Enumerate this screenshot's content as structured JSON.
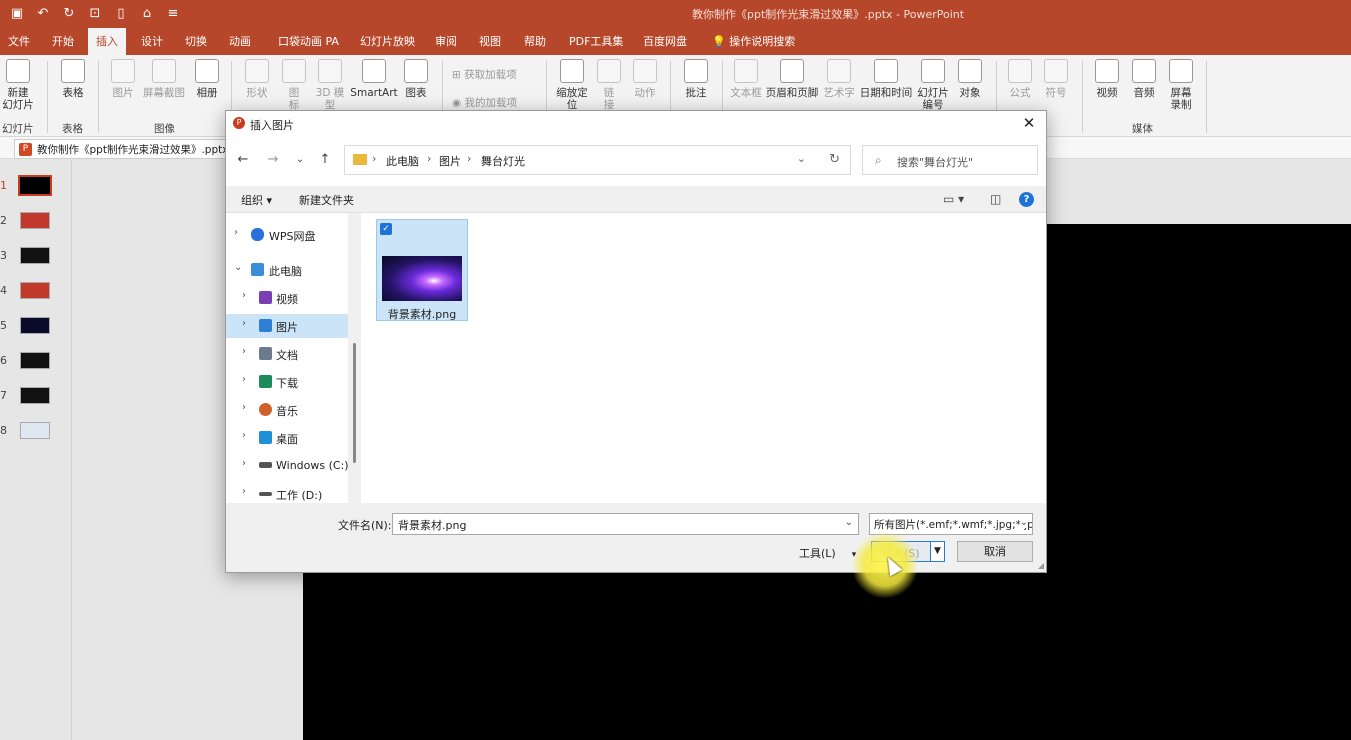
{
  "window": {
    "title": "教你制作《ppt制作光束滑过效果》.pptx - PowerPoint"
  },
  "menu": {
    "tabs": [
      "文件",
      "开始",
      "插入",
      "设计",
      "切换",
      "动画",
      "口袋动画 PA",
      "幻灯片放映",
      "审阅",
      "视图",
      "帮助",
      "PDF工具集",
      "百度网盘"
    ],
    "active": "插入",
    "tell_me": "操作说明搜索"
  },
  "ribbon": {
    "new_slide": "新建\n幻灯片",
    "table": "表格",
    "picture": "图片",
    "screenshot": "屏幕截图",
    "album": "相册",
    "shapes": "形状",
    "icons": "图\n标",
    "model3d": "3D 模\n型",
    "smartart": "SmartArt",
    "chart": "图表",
    "get_addins": "获取加载项",
    "my_addins": "我的加载项",
    "zoom": "缩放定\n位",
    "link": "链\n接",
    "action": "动作",
    "comment": "批注",
    "textbox": "文本框",
    "header_footer": "页眉和页脚",
    "wordart": "艺术字",
    "datetime": "日期和时间",
    "slide_number": "幻灯片\n编号",
    "object": "对象",
    "equation": "公式",
    "symbol": "符号",
    "video": "视频",
    "audio": "音频",
    "screen_record": "屏幕\n录制",
    "groups": {
      "slides": "幻灯片",
      "tables": "表格",
      "images": "图像",
      "media": "媒体"
    }
  },
  "doc_tab": "教你制作《ppt制作光束滑过效果》.pptx",
  "slides": {
    "numbers": [
      "1",
      "2",
      "3",
      "4",
      "5",
      "6",
      "7",
      "8"
    ],
    "selected": "1",
    "thumb_colors": [
      "#000000",
      "#c0392b",
      "#111111",
      "#c0392b",
      "#0a0a2a",
      "#111111",
      "#111111",
      "#dfe8f2"
    ]
  },
  "dialog": {
    "title": "插入图片",
    "close": "✕",
    "breadcrumb": [
      "此电脑",
      "图片",
      "舞台灯光"
    ],
    "search_placeholder": "搜索\"舞台灯光\"",
    "organize": "组织 ▾",
    "new_folder": "新建文件夹",
    "nav": [
      {
        "label": "WPS网盘",
        "color": "#2b6fdc"
      },
      {
        "label": "此电脑",
        "color": "#3a8fd8"
      },
      {
        "label": "视频",
        "color": "#7a3fb3"
      },
      {
        "label": "图片",
        "color": "#2f7fd6"
      },
      {
        "label": "文档",
        "color": "#6b7b8c"
      },
      {
        "label": "下载",
        "color": "#1e8c5a"
      },
      {
        "label": "音乐",
        "color": "#d0602a"
      },
      {
        "label": "桌面",
        "color": "#1e90d6"
      },
      {
        "label": "Windows (C:)",
        "color": "#555555"
      },
      {
        "label": "工作 (D:)",
        "color": "#555555"
      }
    ],
    "file": {
      "name": "背景素材.png"
    },
    "filename_label": "文件名(N):",
    "filename_value": "背景素材.png",
    "filter_value": "所有图片(*.emf;*.wmf;*.jpg;*.jp",
    "tools_label": "工具(L)",
    "insert_label": "插入(S)",
    "cancel_label": "取消"
  }
}
